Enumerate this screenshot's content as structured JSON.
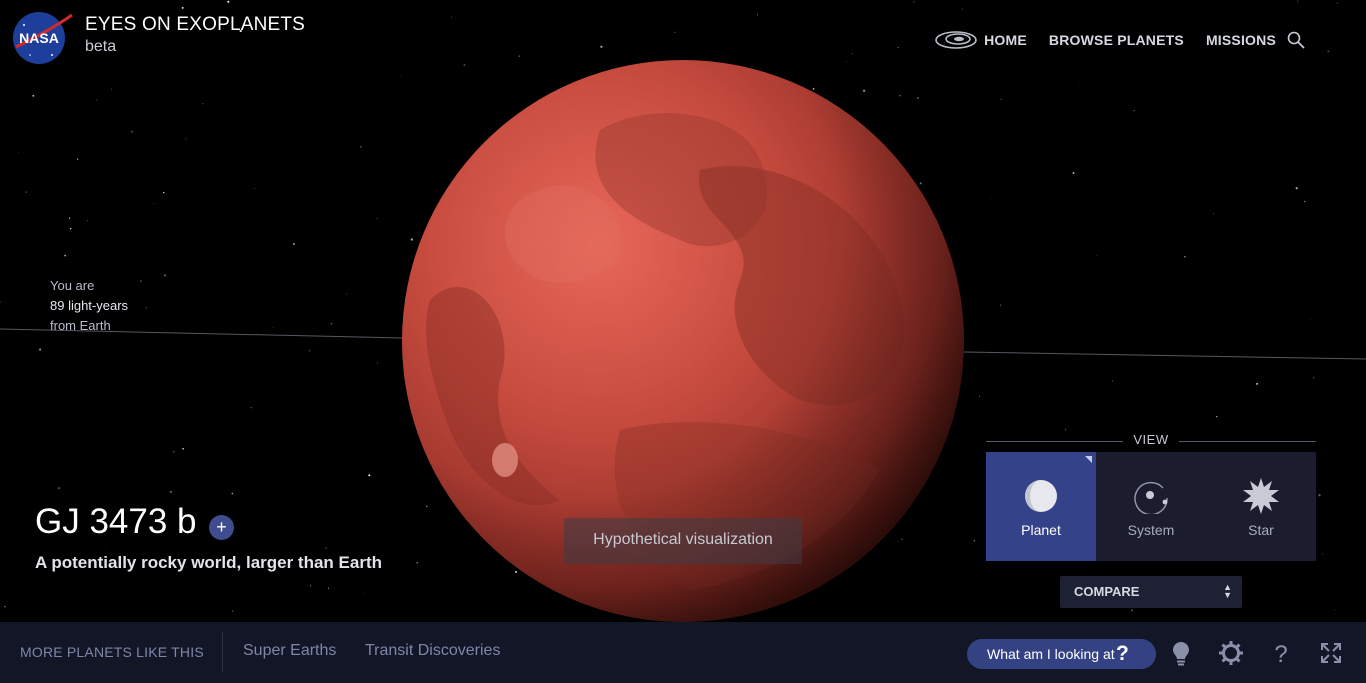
{
  "header": {
    "logo_text": "NASA",
    "title": "EYES ON EXOPLANETS",
    "subtitle": "beta",
    "nav": [
      "HOME",
      "BROWSE PLANETS",
      "MISSIONS"
    ]
  },
  "distance": {
    "line1": "You are",
    "line2": "89 light-years",
    "line3": "from Earth"
  },
  "planet": {
    "name": "GJ 3473 b",
    "add_label": "+",
    "description": "A potentially rocky world, larger than Earth",
    "note": "Hypothetical visualization"
  },
  "view": {
    "title": "VIEW",
    "options": [
      "Planet",
      "System",
      "Star"
    ],
    "active": "Planet"
  },
  "compare": {
    "label": "COMPARE",
    "arrows": "▲▼"
  },
  "bottom": {
    "more_label": "MORE PLANETS LIKE THIS",
    "categories": [
      "Super Earths",
      "Transit Discoveries"
    ],
    "what_label": "What am I looking at",
    "what_q": "?"
  },
  "colors": {
    "accent": "#344283",
    "bar": "#131626",
    "planet": "#c3473c"
  },
  "icons": [
    "search-icon",
    "lightbulb-icon",
    "gear-icon",
    "help-icon",
    "fullscreen-icon",
    "galaxy-icon"
  ]
}
